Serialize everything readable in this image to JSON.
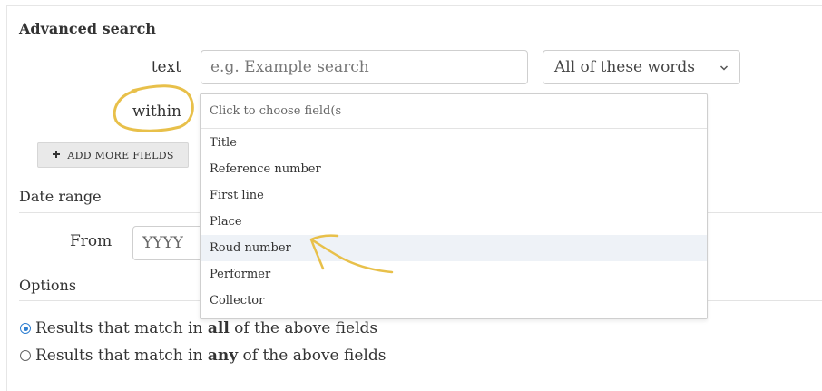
{
  "heading": "Advanced search",
  "text_row": {
    "label": "text",
    "placeholder": "e.g. Example search",
    "match_mode": "All of these words"
  },
  "within_row": {
    "label": "within",
    "dropdown_placeholder": "Click to choose field(s",
    "options": [
      {
        "label": "Title",
        "highlighted": false
      },
      {
        "label": "Reference number",
        "highlighted": false
      },
      {
        "label": "First line",
        "highlighted": false
      },
      {
        "label": "Place",
        "highlighted": false
      },
      {
        "label": "Roud number",
        "highlighted": true
      },
      {
        "label": "Performer",
        "highlighted": false
      },
      {
        "label": "Collector",
        "highlighted": false
      }
    ]
  },
  "add_more_fields": {
    "icon": "plus-icon",
    "label": "ADD MORE FIELDS"
  },
  "date_range": {
    "title": "Date range",
    "from_label": "From",
    "from_placeholder": "YYYY"
  },
  "options": {
    "title": "Options",
    "radios": [
      {
        "prefix": "Results that match in ",
        "emphasis": "all",
        "suffix": " of the above fields",
        "selected": true
      },
      {
        "prefix": "Results that match in ",
        "emphasis": "any",
        "suffix": " of the above fields",
        "selected": false
      }
    ]
  },
  "annotation_color": "#e8c04a"
}
